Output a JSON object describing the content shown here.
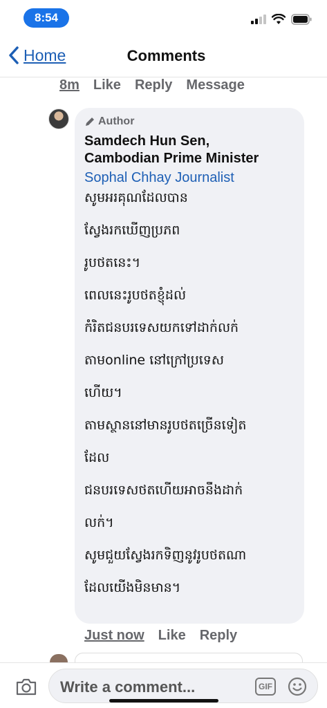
{
  "status_bar": {
    "time": "8:54"
  },
  "nav": {
    "back_label": "Home",
    "title": "Comments"
  },
  "previous_comment_actions": {
    "time": "8m",
    "like": "Like",
    "reply": "Reply",
    "message": "Message"
  },
  "comment": {
    "author_badge": "Author",
    "name_line1": "Samdech Hun Sen,",
    "name_line2": "Cambodian Prime Minister",
    "page_name": "Sophal Chhay Journalist",
    "body_lines": [
      "សូមអរគុណដែលបាន",
      "ស្វែងរកឃើញប្រភព",
      "រូបថតនេះ។",
      "ពេលនេះរូបថតខ្ញុំដល់",
      "កំរិតជនបរទេសយកទៅដាក់លក់",
      "តាមonline នៅក្រៅប្រទេស",
      "ហើយ។",
      "តាមស្ថាននៅមានរូបថតច្រើនទៀត",
      "ដែល",
      "ជនបរទេសថតហើយអាចនឹងដាក់",
      "លក់។",
      "សូមជួយស្វែងរកទិញនូវរូបថតណា",
      "ដែលយើងមិនមាន។"
    ],
    "time": "Just now",
    "like": "Like",
    "reply": "Reply"
  },
  "composer": {
    "placeholder": "Write a comment...",
    "gif_label": "GIF"
  },
  "colors": {
    "accent": "#1d5fb5",
    "time_pill": "#1a73e8",
    "bubble": "#f0f1f5",
    "meta": "#66676b"
  }
}
